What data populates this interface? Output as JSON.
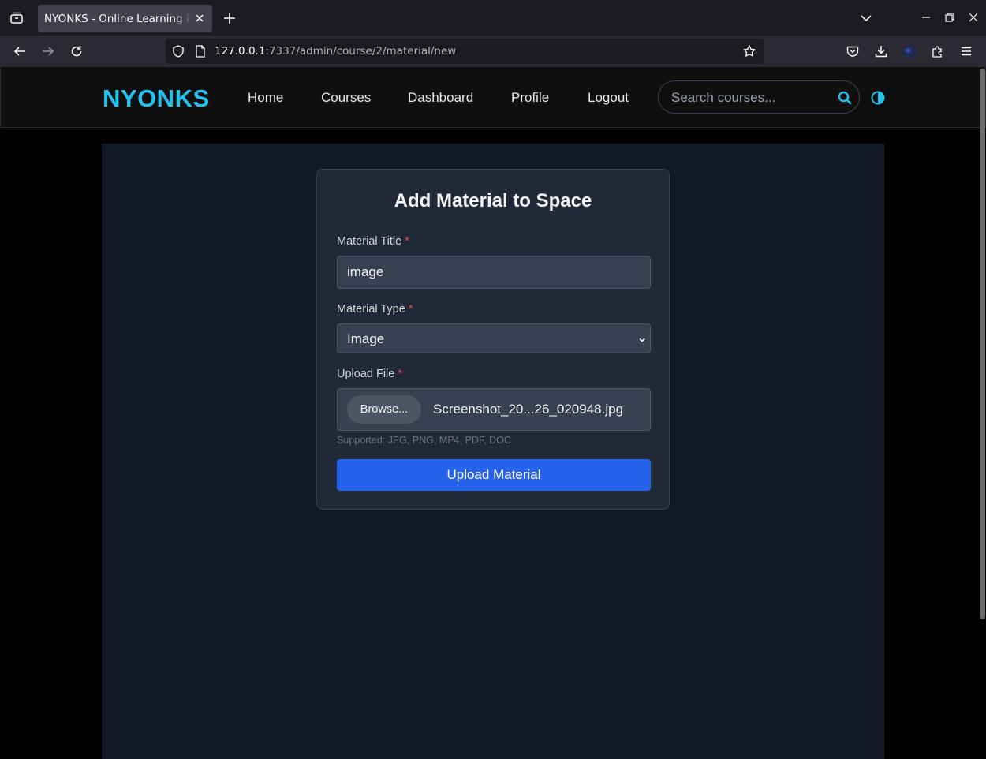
{
  "browser": {
    "tab_title": "NYONKS - Online Learning Platform",
    "url_host": "127.0.0.1",
    "url_rest": ":7337/admin/course/2/material/new"
  },
  "site": {
    "logo": "NYONKS",
    "nav": [
      "Home",
      "Courses",
      "Dashboard",
      "Profile",
      "Logout"
    ],
    "search_placeholder": "Search courses...",
    "accent_color": "#22c1ee"
  },
  "form": {
    "title": "Add Material to Space",
    "title_label": "Material Title",
    "title_value": "image",
    "type_label": "Material Type",
    "type_value": "Image",
    "file_label": "Upload File",
    "browse_label": "Browse...",
    "file_name": "Screenshot_20...26_020948.jpg",
    "hint": "Supported: JPG, PNG, MP4, PDF, DOC",
    "required_mark": "*",
    "submit_label": "Upload Material",
    "submit_color": "#2563eb"
  }
}
